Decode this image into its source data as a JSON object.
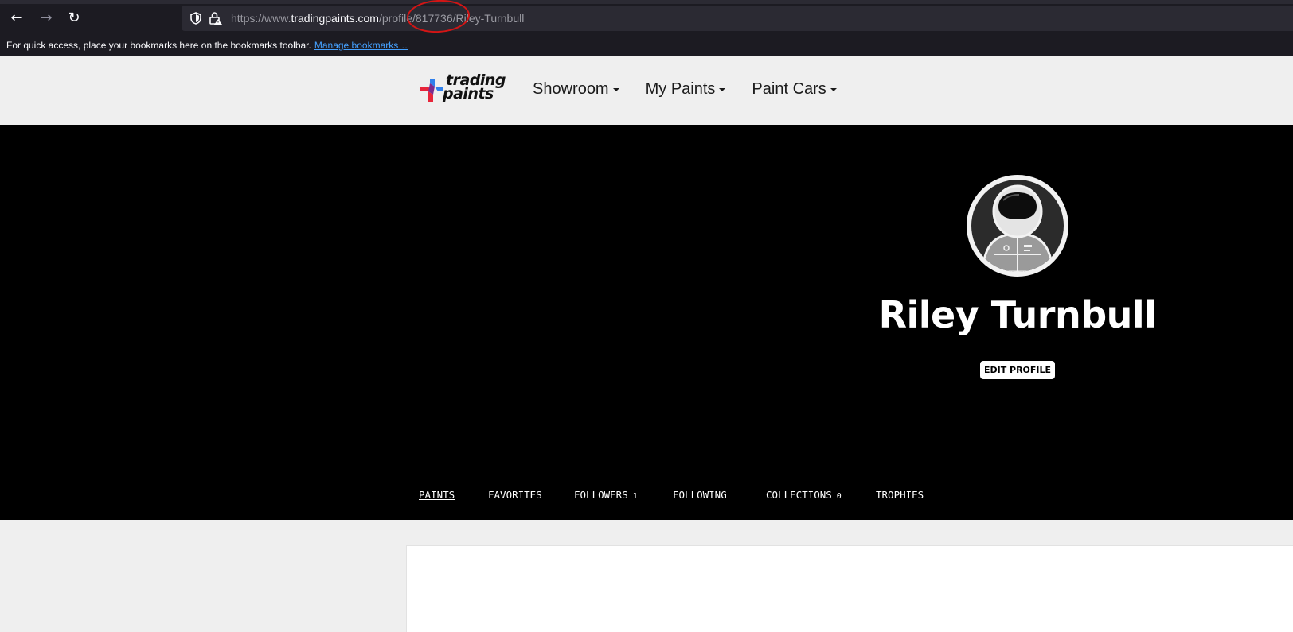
{
  "browser": {
    "url_prefix": "https://www.",
    "url_domain": "tradingpaints.com",
    "url_path": "/profile/817736/Riley-Turnbull",
    "back_glyph": "←",
    "forward_glyph": "→",
    "reload_glyph": "↻",
    "bookmarks_message": "For quick access, place your bookmarks here on the bookmarks toolbar.",
    "manage_bookmarks": "Manage bookmarks…",
    "annotation_color": "#d41515"
  },
  "site": {
    "logo_line1": "trading",
    "logo_line2": "paints",
    "nav": [
      {
        "label": "Showroom"
      },
      {
        "label": "My Paints"
      },
      {
        "label": "Paint Cars"
      }
    ]
  },
  "profile": {
    "name": "Riley Turnbull",
    "edit_label": "EDIT PROFILE",
    "avatar_icon": "racing-driver-helmet-icon",
    "tabs": [
      {
        "label": "PAINTS",
        "count": "",
        "active": true
      },
      {
        "label": "FAVORITES",
        "count": ""
      },
      {
        "label": "FOLLOWERS",
        "count": "1"
      },
      {
        "label": "FOLLOWING",
        "count": ""
      },
      {
        "label": "COLLECTIONS",
        "count": "0"
      },
      {
        "label": "TROPHIES",
        "count": ""
      }
    ]
  },
  "colors": {
    "hero_bg": "#000000",
    "page_bg": "#efefef",
    "logo_blue": "#2f80ed",
    "logo_red": "#e8253a"
  }
}
